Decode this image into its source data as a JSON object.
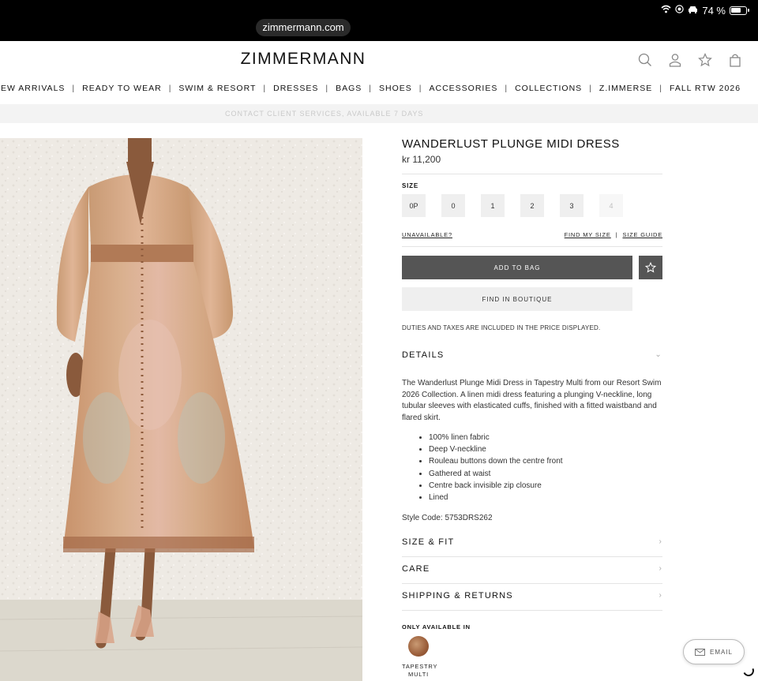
{
  "status": {
    "battery": "74 %",
    "battery_level": 0.74
  },
  "browser": {
    "url": "zimmermann.com"
  },
  "brand": {
    "logo": "ZIMMERMANN"
  },
  "nav": {
    "items": [
      "EW ARRIVALS",
      "READY TO WEAR",
      "SWIM & RESORT",
      "DRESSES",
      "BAGS",
      "SHOES",
      "ACCESSORIES",
      "COLLECTIONS",
      "Z.IMMERSE",
      "FALL RTW 2026"
    ],
    "separator": "|"
  },
  "promo": {
    "text": "CONTACT CLIENT SERVICES, AVAILABLE 7 DAYS"
  },
  "product": {
    "title": "WANDERLUST PLUNGE MIDI DRESS",
    "price": "kr 11,200",
    "size_label": "SIZE",
    "sizes": [
      {
        "label": "0P",
        "available": true
      },
      {
        "label": "0",
        "available": true
      },
      {
        "label": "1",
        "available": true
      },
      {
        "label": "2",
        "available": true
      },
      {
        "label": "3",
        "available": true
      },
      {
        "label": "4",
        "available": false
      }
    ],
    "unavailable_link": "UNAVAILABLE?",
    "find_my_size": "FIND MY SIZE",
    "link_separator": "|",
    "size_guide": "SIZE GUIDE",
    "add_to_bag": "ADD TO BAG",
    "find_in_boutique": "FIND IN BOUTIQUE",
    "duties_note": "DUTIES AND TAXES ARE INCLUDED IN THE PRICE DISPLAYED.",
    "details_heading": "DETAILS",
    "description": "The Wanderlust Plunge Midi Dress in Tapestry Multi from our Resort Swim 2026 Collection. A linen midi dress featuring a plunging V-neckline, long tubular sleeves with elasticated cuffs, finished with a fitted waistband and flared skirt.",
    "bullets": [
      "100% linen fabric",
      "Deep V-neckline",
      "Rouleau buttons down the centre front",
      "Gathered at waist",
      "Centre back invisible zip closure",
      "Lined"
    ],
    "style_code": "Style Code: 5753DRS262",
    "accordions": [
      "SIZE & FIT",
      "CARE",
      "SHIPPING & RETURNS"
    ],
    "only_available_label": "ONLY AVAILABLE IN",
    "swatch_line1": "TAPESTRY",
    "swatch_line2": "MULTI"
  },
  "floating": {
    "email": "EMAIL"
  },
  "colors": {
    "accent_button": "#555555",
    "size_bg": "#efefef",
    "dress_tan": "#c9946a",
    "dress_rose": "#d8a590"
  },
  "icons": [
    "wifi-icon",
    "location-icon",
    "car-icon",
    "search-icon",
    "account-icon",
    "wishlist-icon",
    "bag-icon",
    "star-icon",
    "chevron-right-icon",
    "chevron-down-icon",
    "email-icon"
  ]
}
